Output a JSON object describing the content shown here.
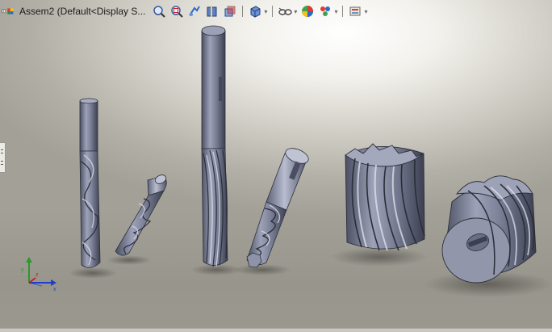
{
  "document": {
    "title": "Assem2  (Default<Display S..."
  },
  "toolbar": {
    "icons": [
      "assembly-tree-icon",
      "zoom-to-fit-icon",
      "zoom-to-area-icon",
      "previous-view-icon",
      "section-view-icon",
      "dynamic-annotation-icon",
      "view-orientation-icon",
      "display-style-icon",
      "hide-show-items-icon",
      "edit-appearance-icon",
      "apply-scene-icon",
      "view-settings-icon"
    ]
  },
  "scene": {
    "models": [
      "twist-drill",
      "short-twist-drill",
      "long-end-mill",
      "roughing-end-mill",
      "helical-shell-cutter",
      "helical-face-mill"
    ]
  },
  "triad": {
    "axes": [
      "x",
      "y",
      "z"
    ]
  }
}
